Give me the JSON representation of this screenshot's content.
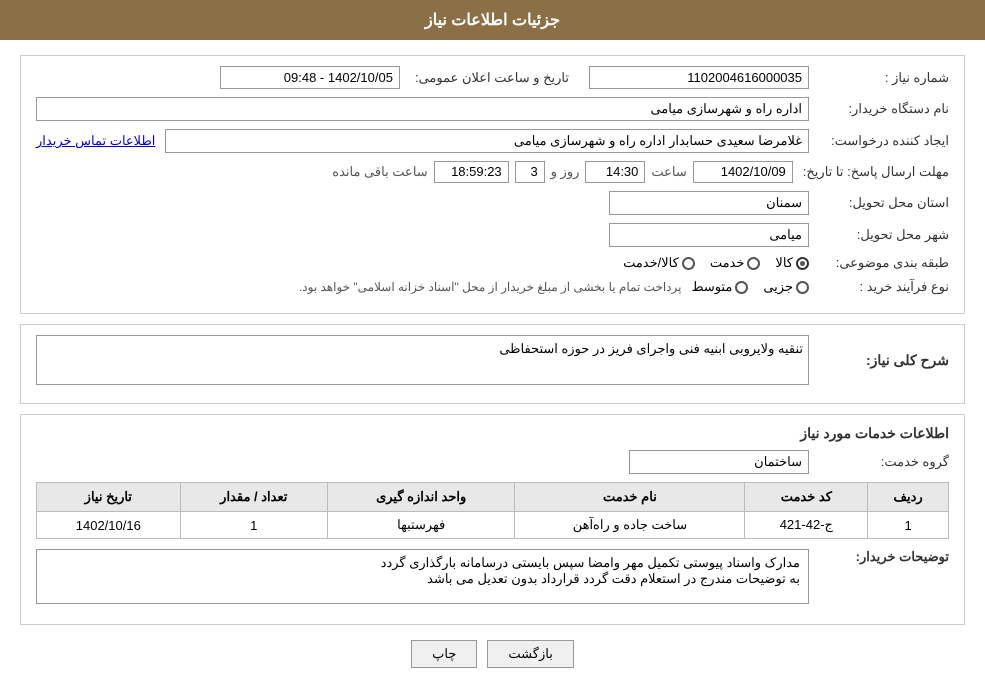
{
  "header": {
    "title": "جزئیات اطلاعات نیاز"
  },
  "form": {
    "need_number_label": "شماره نیاز :",
    "need_number_value": "1102004616000035",
    "buyer_org_label": "نام دستگاه خریدار:",
    "buyer_org_value": "اداره راه و شهرسازی میامی",
    "creator_label": "ایجاد کننده درخواست:",
    "creator_value": "غلامرضا سعیدی حسابدار اداره راه و شهرسازی میامی",
    "contact_link": "اطلاعات تماس خریدار",
    "deadline_label": "مهلت ارسال پاسخ: تا تاریخ:",
    "deadline_date": "1402/10/09",
    "deadline_time_label": "ساعت",
    "deadline_time": "14:30",
    "deadline_days_label": "روز و",
    "deadline_days": "3",
    "deadline_remaining_label": "ساعت باقی مانده",
    "deadline_remaining": "18:59:23",
    "province_label": "استان محل تحویل:",
    "province_value": "سمنان",
    "city_label": "شهر محل تحویل:",
    "city_value": "میامی",
    "category_label": "طبقه بندی موضوعی:",
    "category_radio1": "کالا",
    "category_radio2": "خدمت",
    "category_radio3": "کالا/خدمت",
    "purchase_type_label": "نوع فرآیند خرید :",
    "purchase_type_radio1": "جزیی",
    "purchase_type_radio2": "متوسط",
    "purchase_note": "پرداخت تمام یا بخشی از مبلغ خریدار از محل \"اسناد خزانه اسلامی\" خواهد بود.",
    "announcement_label": "تاریخ و ساعت اعلان عمومی:",
    "announcement_value": "1402/10/05 - 09:48",
    "general_desc_label": "شرح کلی نیاز:",
    "general_desc_value": "تنقیه ولایروبی ابنیه فنی واجرای فریز در حوزه استحفاظی",
    "services_info_title": "اطلاعات خدمات مورد نیاز",
    "service_group_label": "گروه خدمت:",
    "service_group_value": "ساختمان",
    "table": {
      "headers": [
        "ردیف",
        "کد خدمت",
        "نام خدمت",
        "واحد اندازه گیری",
        "تعداد / مقدار",
        "تاریخ نیاز"
      ],
      "rows": [
        {
          "row": "1",
          "code": "ج-42-421",
          "name": "ساخت جاده و راه‌آهن",
          "unit": "فهرستبها",
          "qty": "1",
          "date": "1402/10/16"
        }
      ]
    },
    "buyer_notes_label": "توضیحات خریدار:",
    "buyer_notes_value": "مدارک واسناد پیوستی تکمیل مهر وامضا سپس بایستی درسامانه بارگذاری گردد\nبه توضیحات مندرج در استعلام دقت گردد قرارداد بدون تعدیل می باشد",
    "buttons": {
      "print": "چاپ",
      "back": "بازگشت"
    }
  }
}
